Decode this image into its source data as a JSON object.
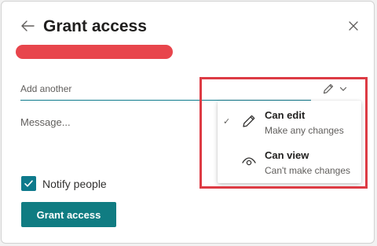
{
  "dialog": {
    "title": "Grant access",
    "back_icon": "arrow-left-icon",
    "close_icon": "close-icon"
  },
  "recipients": {
    "placeholder": "Add another",
    "permission_icon": "pencil-icon",
    "dropdown_icon": "chevron-down-icon"
  },
  "permission_menu": {
    "items": [
      {
        "title": "Can edit",
        "description": "Make any changes",
        "icon": "pencil-icon",
        "selected": true
      },
      {
        "title": "Can view",
        "description": "Can't make changes",
        "icon": "eye-icon",
        "selected": false
      }
    ],
    "selected_mark": "✓"
  },
  "message": {
    "placeholder": "Message..."
  },
  "notify": {
    "label": "Notify people",
    "checked": true
  },
  "actions": {
    "grant_label": "Grant access"
  },
  "colors": {
    "accent": "#107c82",
    "annotation_red": "#dd3b44"
  }
}
